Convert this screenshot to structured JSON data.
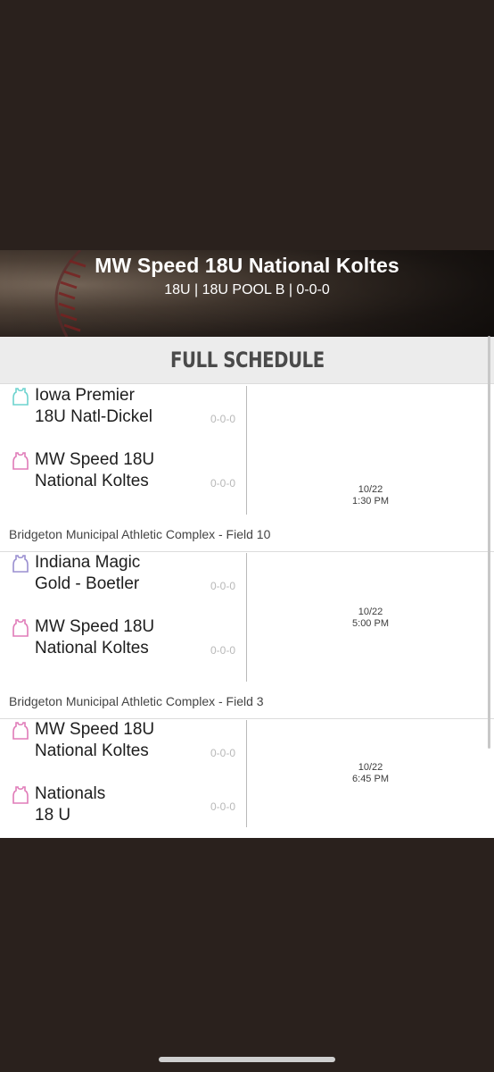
{
  "header": {
    "team_title": "MW Speed 18U National Koltes",
    "subtitle": "18U | 18U POOL B | 0-0-0"
  },
  "section": {
    "title": "FULL SCHEDULE"
  },
  "games": [
    {
      "away": {
        "name": "Iowa Premier 18U Natl-Dickel",
        "record": "0-0-0",
        "jersey_color": "#6dd3cf"
      },
      "home": {
        "name": "MW Speed 18U National Koltes",
        "record": "0-0-0",
        "jersey_color": "#e07bb8"
      },
      "date": "10/22",
      "time": "1:30 PM",
      "location": "Bridgeton Municipal Athletic Complex - Field 10"
    },
    {
      "away": {
        "name": "Indiana Magic Gold - Boetler",
        "record": "0-0-0",
        "jersey_color": "#9a8fd0"
      },
      "home": {
        "name": "MW Speed 18U National Koltes",
        "record": "0-0-0",
        "jersey_color": "#e07bb8"
      },
      "date": "10/22",
      "time": "5:00 PM",
      "location": "Bridgeton Municipal Athletic Complex - Field 3"
    },
    {
      "away": {
        "name": "MW Speed 18U National Koltes",
        "record": "0-0-0",
        "jersey_color": "#e07bb8"
      },
      "home": {
        "name": "Nationals 18 U",
        "record": "0-0-0",
        "jersey_color": "#e07bb8"
      },
      "date": "10/22",
      "time": "6:45 PM",
      "location": ""
    }
  ]
}
